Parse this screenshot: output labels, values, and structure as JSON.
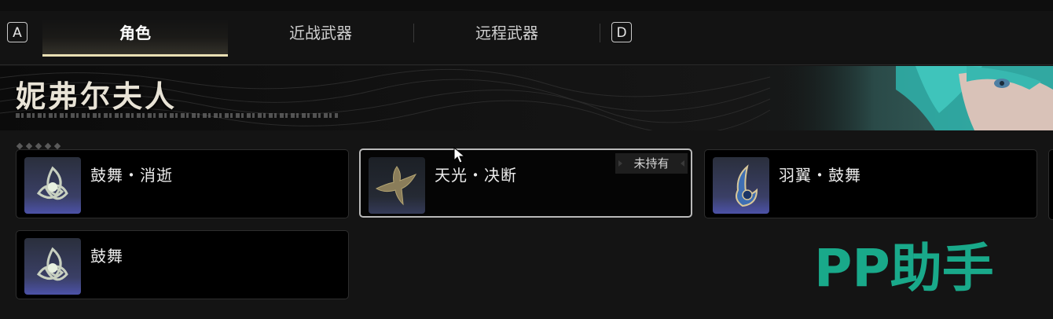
{
  "tabs": {
    "left_key": "A",
    "right_key": "D",
    "items": [
      {
        "label": "角色",
        "active": true
      },
      {
        "label": "近战武器",
        "active": false
      },
      {
        "label": "远程武器",
        "active": false
      }
    ]
  },
  "banner": {
    "title": "妮弗尔夫人"
  },
  "cards": [
    {
      "name": "鼓舞・消逝",
      "owned": true,
      "icon": "triquetra-emblem-icon"
    },
    {
      "name": "天光・决断",
      "owned": false,
      "status": "未持有",
      "icon": "dragon-emblem-icon",
      "selected": true
    },
    {
      "name": "羽翼・鼓舞",
      "owned": true,
      "icon": "feather-wing-icon"
    },
    {
      "name": "鼓舞",
      "owned": true,
      "icon": "triquetra-emblem-icon"
    }
  ],
  "watermark": {
    "text": "PP助手"
  },
  "colors": {
    "accent": "#e9dfb4",
    "watermark": "#19a98a",
    "background": "#121212"
  }
}
